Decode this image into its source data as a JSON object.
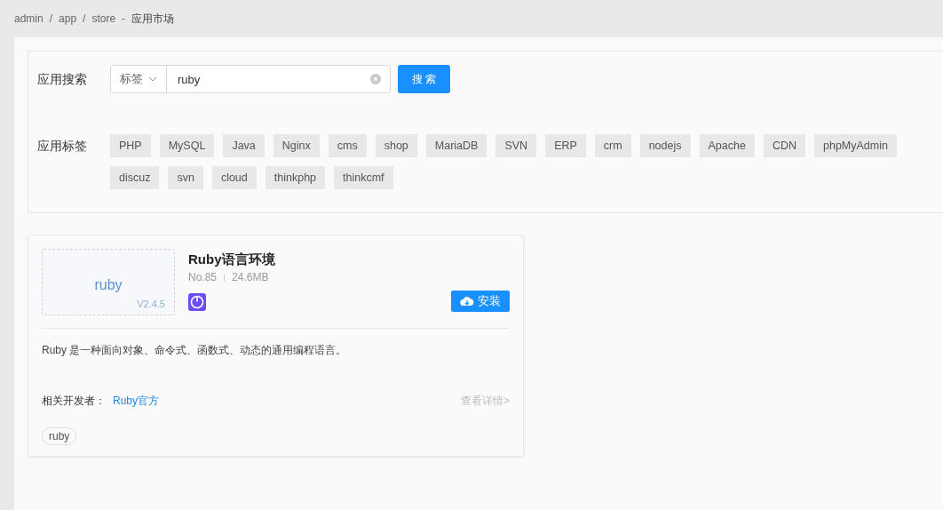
{
  "breadcrumb": {
    "path": [
      "admin",
      "app",
      "store"
    ],
    "separators": [
      "/",
      "/"
    ],
    "title_separator": "-",
    "title": "应用市场"
  },
  "search": {
    "label": "应用搜索",
    "filter": "标签",
    "value": "ruby",
    "button": "搜 索"
  },
  "tags": {
    "label": "应用标签",
    "items": [
      "PHP",
      "MySQL",
      "Java",
      "Nginx",
      "cms",
      "shop",
      "MariaDB",
      "SVN",
      "ERP",
      "crm",
      "nodejs",
      "Apache",
      "CDN",
      "phpMyAdmin",
      "discuz",
      "svn",
      "cloud",
      "thinkphp",
      "thinkcmf"
    ]
  },
  "apps": [
    {
      "logo_text": "ruby",
      "version": "V2.4.5",
      "name": "Ruby语言环境",
      "number": "No.85",
      "size": "24.6MB",
      "install": "安装",
      "description": "Ruby 是一种面向对象、命令式、函数式、动态的通用编程语言。",
      "developer_label": "相关开发者：",
      "developer": "Ruby官方",
      "details": "查看详情>",
      "tags": [
        "ruby"
      ]
    }
  ]
}
